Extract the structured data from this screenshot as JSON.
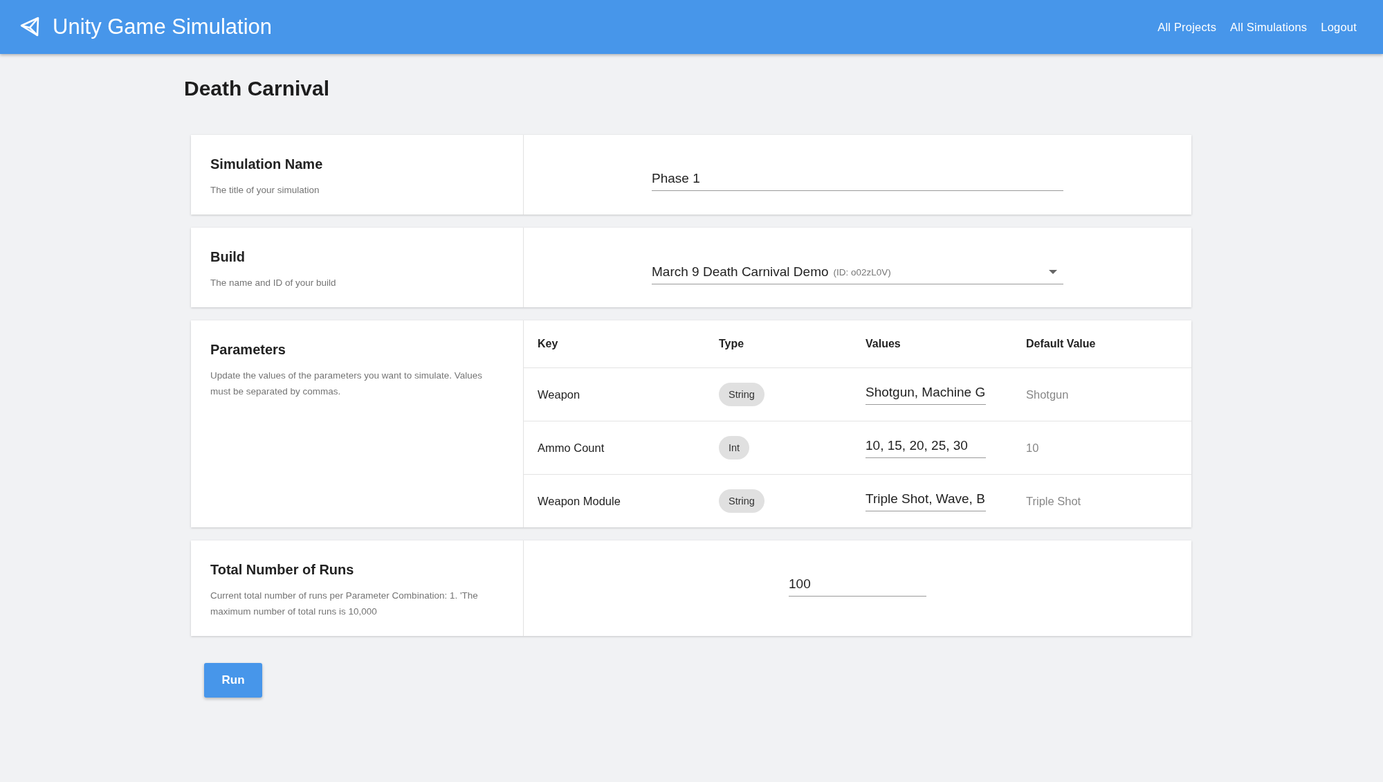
{
  "header": {
    "title": "Unity Game Simulation",
    "nav": [
      "All Projects",
      "All Simulations",
      "Logout"
    ]
  },
  "page_title": "Death Carnival",
  "sections": [
    {
      "kind": "text_field",
      "title": "Simulation Name",
      "description": "The title of your simulation",
      "value": "Phase 1"
    },
    {
      "kind": "select",
      "title": "Build",
      "description": "The name and ID of your build",
      "value": "March 9 Death Carnival Demo",
      "detail": "(ID: o02zL0V)"
    },
    {
      "kind": "parameters",
      "title": "Parameters",
      "description": "Update the values of the parameters you want to simulate. Values must be separated by commas.",
      "columns": [
        "Key",
        "Type",
        "Values",
        "Default Value"
      ],
      "rows": [
        {
          "key": "Weapon",
          "type": "String",
          "values": "Shotgun, Machine G",
          "default": "Shotgun"
        },
        {
          "key": "Ammo Count",
          "type": "Int",
          "values": "10, 15, 20, 25, 30",
          "default": "10"
        },
        {
          "key": "Weapon Module",
          "type": "String",
          "values": "Triple Shot, Wave, B",
          "default": "Triple Shot"
        }
      ]
    },
    {
      "kind": "number_field",
      "title": "Total Number of Runs",
      "description": "Current total number of runs per Parameter Combination: 1. 'The maximum number of total runs is 10,000",
      "value": "100"
    }
  ],
  "run_button": "Run"
}
